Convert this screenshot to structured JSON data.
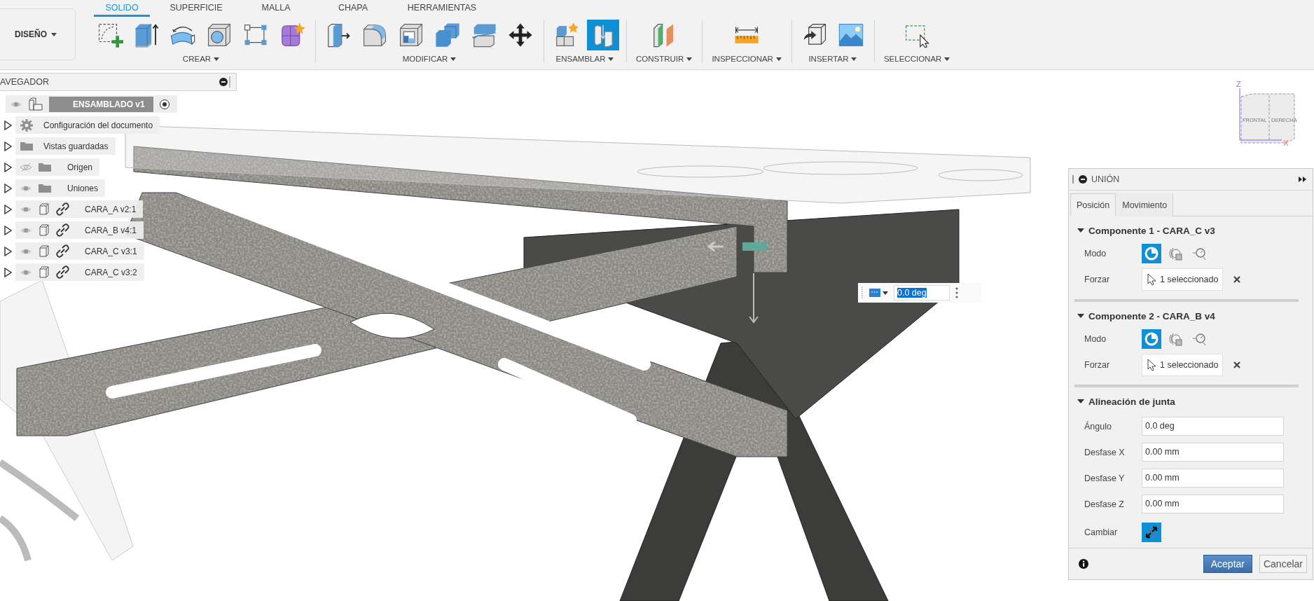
{
  "toolbar": {
    "workspace": {
      "label": "DISEÑO"
    },
    "tabs": [
      {
        "label": "SOLIDO",
        "selected": true
      },
      {
        "label": "SUPERFICIE",
        "selected": false
      },
      {
        "label": "MALLA",
        "selected": false
      },
      {
        "label": "CHAPA",
        "selected": false
      },
      {
        "label": "HERRAMIENTAS",
        "selected": false
      }
    ],
    "groups": [
      {
        "label": "CREAR",
        "tools": [
          {
            "kind": "sketch",
            "active": false
          },
          {
            "kind": "extrude",
            "active": false
          },
          {
            "kind": "revolve",
            "active": false
          },
          {
            "kind": "hole",
            "active": false
          },
          {
            "kind": "pattern",
            "active": false
          },
          {
            "kind": "form",
            "active": false
          }
        ]
      },
      {
        "label": "MODIFICAR",
        "tools": [
          {
            "kind": "presspull",
            "active": false
          },
          {
            "kind": "fillet",
            "active": false
          },
          {
            "kind": "shell",
            "active": false
          },
          {
            "kind": "combine",
            "active": false
          },
          {
            "kind": "split",
            "active": false
          },
          {
            "kind": "move",
            "active": false
          }
        ]
      },
      {
        "label": "ENSAMBLAR",
        "tools": [
          {
            "kind": "component",
            "active": false
          },
          {
            "kind": "joint",
            "active": true
          }
        ]
      },
      {
        "label": "CONSTRUIR",
        "tools": [
          {
            "kind": "plane",
            "active": false
          }
        ]
      },
      {
        "label": "INSPECCIONAR",
        "tools": [
          {
            "kind": "measure",
            "active": false
          }
        ]
      },
      {
        "label": "INSERTAR",
        "tools": [
          {
            "kind": "insert",
            "active": false
          },
          {
            "kind": "canvas",
            "active": false
          }
        ]
      },
      {
        "label": "SELECCIONAR",
        "tools": [
          {
            "kind": "select",
            "active": false
          }
        ]
      }
    ]
  },
  "browser": {
    "title": "AVEGADOR",
    "root": {
      "label": "ENSAMBLADO v1"
    },
    "items": [
      {
        "label": "Configuración del documento",
        "kind": "settings",
        "expanded": false
      },
      {
        "label": "Vistas guardadas",
        "kind": "folder",
        "expanded": false
      },
      {
        "label": "Origen",
        "kind": "folder",
        "visible": false,
        "expanded": false
      },
      {
        "label": "Uniones",
        "kind": "folder",
        "visible": true,
        "expanded": false
      },
      {
        "label": "CARA_A v2:1",
        "kind": "component",
        "visible": true,
        "expanded": false
      },
      {
        "label": "CARA_B v4:1",
        "kind": "component",
        "visible": true,
        "expanded": false
      },
      {
        "label": "CARA_C v3:1",
        "kind": "component",
        "visible": true,
        "expanded": false
      },
      {
        "label": "CARA_C v3:2",
        "kind": "component",
        "visible": true,
        "expanded": false
      }
    ]
  },
  "viewcube": {
    "faces": [
      "FRONTAL",
      "DERECHA"
    ],
    "axes": [
      "Z",
      "X"
    ]
  },
  "inline_input": {
    "value": "0.0 deg"
  },
  "joint_panel": {
    "title": "UNIÓN",
    "tabs": [
      {
        "label": "Posición",
        "selected": true
      },
      {
        "label": "Movimiento",
        "selected": false
      }
    ],
    "sections": [
      {
        "kind": "component",
        "title": "Componente 1 - CARA_C v3",
        "expanded": true,
        "mode_label": "Modo",
        "modes": [
          {
            "kind": "simple",
            "selected": true
          },
          {
            "kind": "between",
            "selected": false
          },
          {
            "kind": "center",
            "selected": false
          }
        ],
        "snap_label": "Forzar",
        "snap_value": "1 seleccionado"
      },
      {
        "kind": "component",
        "title": "Componente 2 - CARA_B v4",
        "expanded": true,
        "mode_label": "Modo",
        "modes": [
          {
            "kind": "simple",
            "selected": true
          },
          {
            "kind": "between",
            "selected": false
          },
          {
            "kind": "center",
            "selected": false
          }
        ],
        "snap_label": "Forzar",
        "snap_value": "1 seleccionado"
      },
      {
        "kind": "alignment",
        "title": "Alineación de junta",
        "expanded": true,
        "fields": [
          {
            "label": "Ángulo",
            "value": "0.0 deg"
          },
          {
            "label": "Desfase X",
            "value": "0.00 mm"
          },
          {
            "label": "Desfase Y",
            "value": "0.00 mm"
          },
          {
            "label": "Desfase Z",
            "value": "0.00 mm"
          }
        ],
        "flip_label": "Cambiar"
      }
    ],
    "buttons": [
      {
        "label": "Aceptar",
        "kind": "primary"
      },
      {
        "label": "Cancelar",
        "kind": "secondary"
      }
    ]
  }
}
